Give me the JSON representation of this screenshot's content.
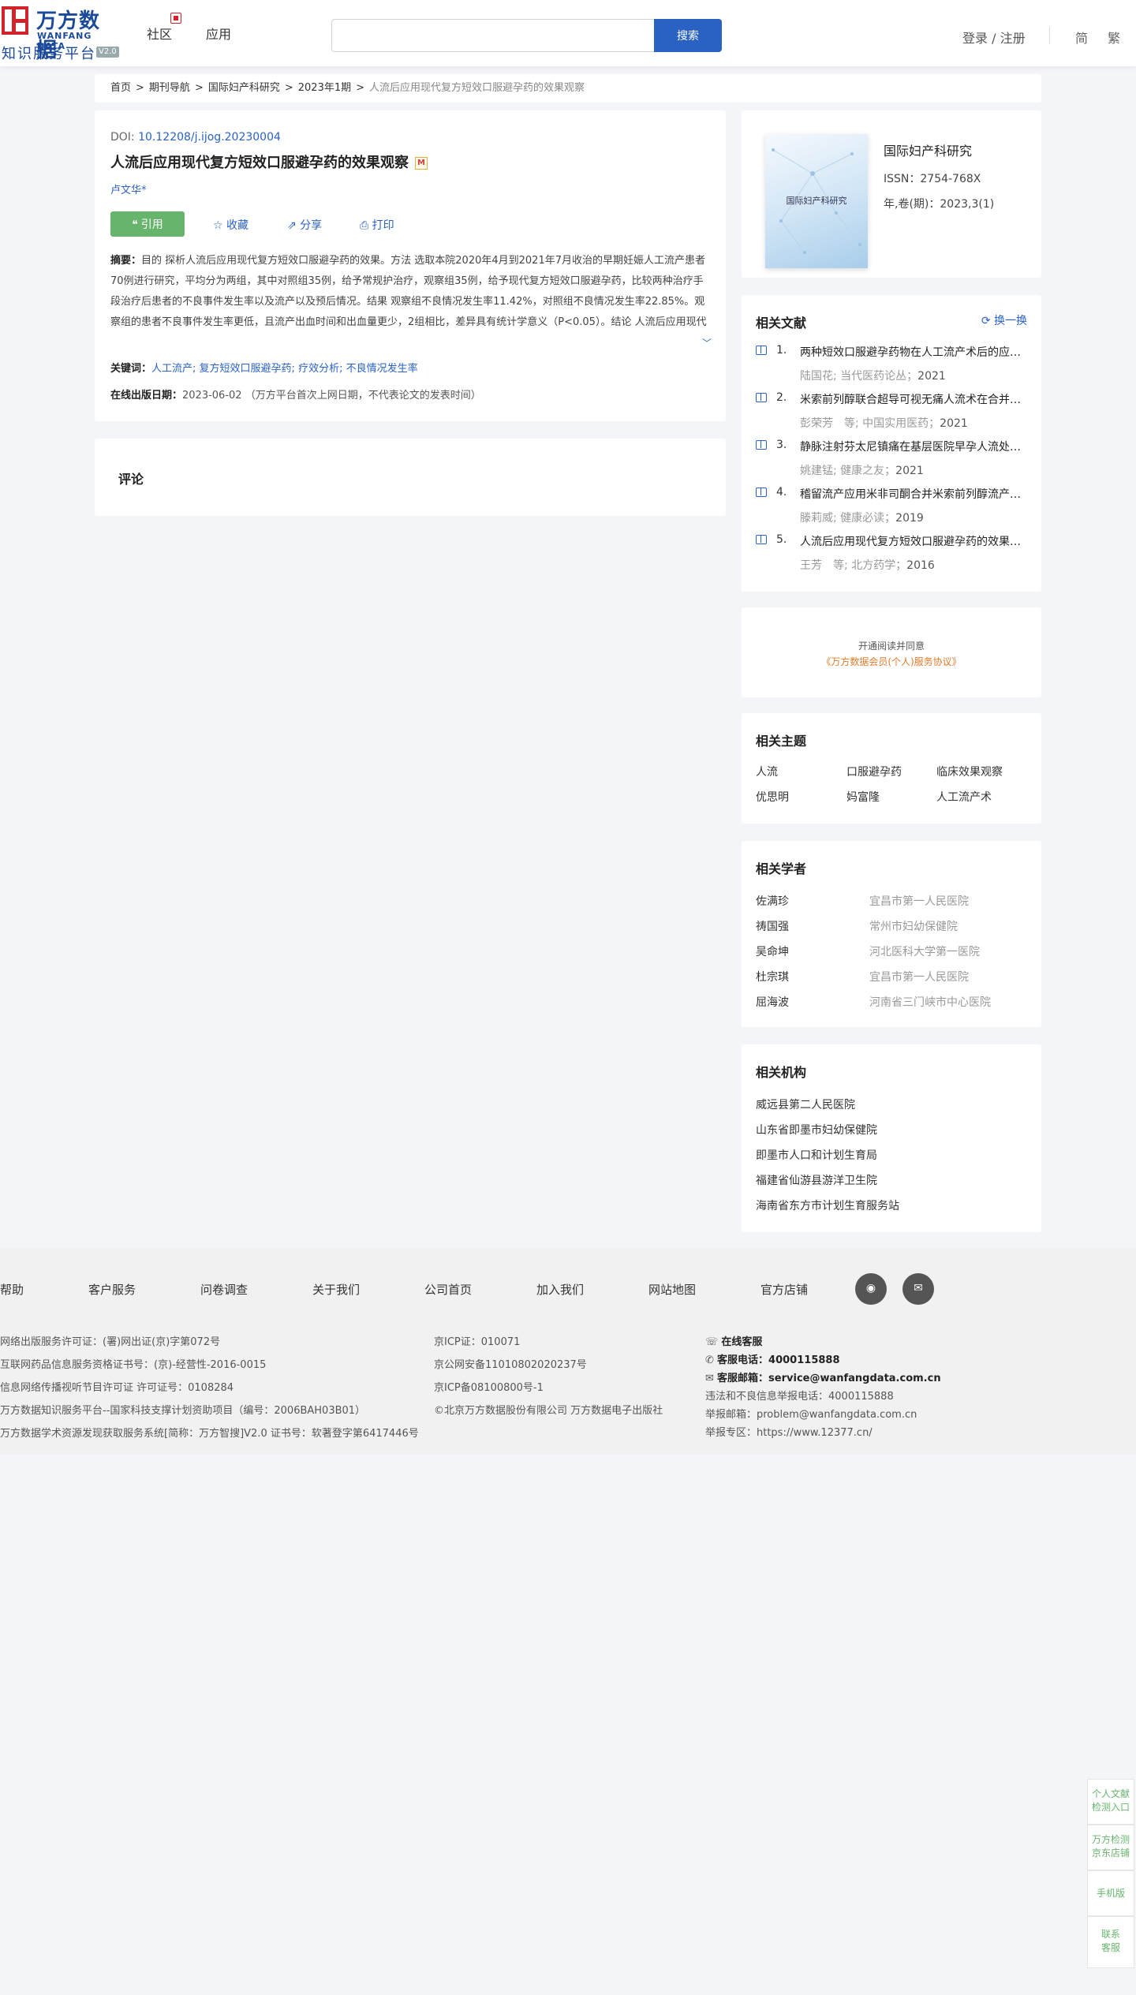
{
  "header": {
    "logo_cn": "万方数据",
    "logo_en": "WANFANG DATA",
    "logo_sub": "知识服务平台",
    "logo_ver": "V2.0",
    "nav": [
      "社区",
      "应用"
    ],
    "search_placeholder": "",
    "search_btn": "搜索",
    "login": "登录 / 注册",
    "lang_simplified": "简",
    "lang_traditional": "繁"
  },
  "breadcrumb": {
    "items": [
      "首页",
      "期刊导航",
      "国际妇产科研究",
      "2023年1期"
    ],
    "separator": ">",
    "current": "人流后应用现代复方短效口服避孕药的效果观察"
  },
  "article": {
    "doi_label": "DOI: ",
    "doi": "10.12208/j.ijog.20230004",
    "title": "人流后应用现代复方短效口服避孕药的效果观察",
    "badge": "M",
    "author": "卢文华*",
    "actions": {
      "cite": "引用",
      "favorite": "收藏",
      "share": "分享",
      "print": "打印"
    },
    "abstract_label": "摘要：",
    "abstract": "目的 探析人流后应用现代复方短效口服避孕药的效果。方法 选取本院2020年4月到2021年7月收治的早期妊娠人工流产患者70例进行研究，平均分为两组，其中对照组35例，给予常规护治疗，观察组35例，给予现代复方短效口服避孕药，比较两种治疗手段治疗后患者的不良事件发生率以及流产以及预后情况。结果 观察组不良情况发生率11.42%，对照组不良情况发生率22.85%。观察组的患者不良事件发生率更低，且流产出血时间和出血量更少，2组相比，差异具有统计学意义（P<0.05）。结论 人流后应用现代复方短效口服避孕药，可以减少盆腔炎、闭经等不良事件的发生率，促进患者身体恢复",
    "keywords_label": "关键词：",
    "keywords": [
      "人工流产;",
      "复方短效口服避孕药;",
      "疗效分析;",
      "不良情况发生率"
    ],
    "pubdate_label": "在线出版日期：",
    "pubdate": "2023-06-02",
    "pubdate_note": "（万方平台首次上网日期，不代表论文的发表时间）"
  },
  "comment": {
    "title": "评论"
  },
  "journal": {
    "cover_text": "国际妇产科研究",
    "name": "国际妇产科研究",
    "issn": "ISSN：2754-768X",
    "issue": "年,卷(期)：2023,3(1)"
  },
  "related_docs": {
    "title": "相关文献",
    "swap": "换一换",
    "items": [
      {
        "num": "1.",
        "title": "两种短效口服避孕药物在人工流产术后的应用效果观察",
        "meta": "陆国花; 当代医药论丛；",
        "year": "2021"
      },
      {
        "num": "2.",
        "title": "米索前列醇联合超导可视无痛人流术在合并瘢痕子宫早孕中的应用",
        "meta": "彭荣芳　等; 中国实用医药；",
        "year": "2021"
      },
      {
        "num": "3.",
        "title": "静脉注射芬太尼镇痛在基层医院早孕人流处理中的应用",
        "meta": "姚建锰; 健康之友；",
        "year": "2021"
      },
      {
        "num": "4.",
        "title": "稽留流产应用米非司酮合并米索前列醇流产的临床效果",
        "meta": "滕莉威; 健康必读；",
        "year": "2019"
      },
      {
        "num": "5.",
        "title": "人流后应用现代复方短效口服避孕药的效果观察",
        "meta": "王芳　等; 北方药学；",
        "year": "2016"
      }
    ]
  },
  "agreement": {
    "line1": "开通阅读并同意",
    "line2": "《万方数据会员(个人)服务协议》"
  },
  "topics": {
    "title": "相关主题",
    "items": [
      "人流",
      "口服避孕药",
      "临床效果观察",
      "优思明",
      "妈富隆",
      "人工流产术"
    ]
  },
  "scholars": {
    "title": "相关学者",
    "items": [
      {
        "name": "佐满珍",
        "org": "宜昌市第一人民医院"
      },
      {
        "name": "祷国强",
        "org": "常州市妇幼保健院"
      },
      {
        "name": "吴命坤",
        "org": "河北医科大学第一医院"
      },
      {
        "name": "杜宗琪",
        "org": "宜昌市第一人民医院"
      },
      {
        "name": "屈海波",
        "org": "河南省三门峡市中心医院"
      }
    ]
  },
  "institutions": {
    "title": "相关机构",
    "items": [
      "威远县第二人民医院",
      "山东省即墨市妇幼保健院",
      "即墨市人口和计划生育局",
      "福建省仙游县游洋卫生院",
      "海南省东方市计划生育服务站"
    ]
  },
  "footer": {
    "links": [
      "帮助",
      "客户服务",
      "问卷调查",
      "关于我们",
      "公司首页",
      "加入我们",
      "网站地图",
      "官方店铺"
    ],
    "social": [
      "weibo-icon",
      "wechat-icon"
    ],
    "col1": [
      "网络出版服务许可证：(署)网出证(京)字第072号",
      "互联网药品信息服务资格证书号：(京)-经营性-2016-0015",
      "信息网络传播视听节目许可证 许可证号：0108284",
      "万方数据知识服务平台--国家科技支撑计划资助项目（编号：2006BAH03B01）",
      "万方数据学术资源发现获取服务系统[简称：万方智搜]V2.0 证书号：软著登字第6417446号"
    ],
    "col2": [
      "京ICP证：010071",
      "京公网安备11010802020237号",
      "京ICP备08100800号-1",
      "©北京万方数据股份有限公司 万方数据电子出版社"
    ],
    "online_service": "在线客服",
    "phone_label": "客服电话：",
    "phone": "4000115888",
    "email_label": "客服邮箱：",
    "email": "service@wanfangdata.com.cn",
    "report_phone": "违法和不良信息举报电话：4000115888",
    "report_email": "举报邮箱：problem@wanfangdata.com.cn",
    "report_zone": "举报专区：https://www.12377.cn/"
  },
  "side_float": [
    "个人文献检测入口",
    "万方检测京东店铺",
    "手机版",
    "联系客服"
  ]
}
